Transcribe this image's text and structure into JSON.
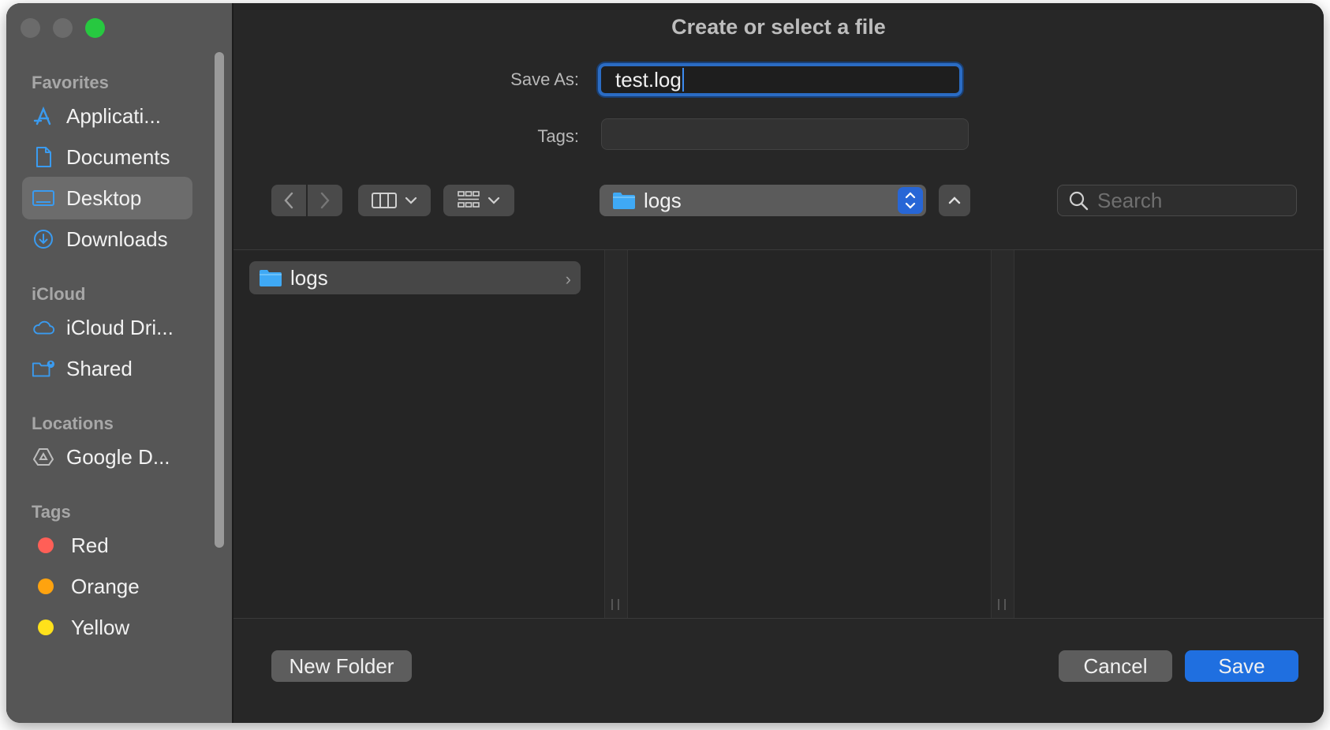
{
  "window": {
    "title": "Create or select a file"
  },
  "sidebar": {
    "favorites_heading": "Favorites",
    "favorites": [
      {
        "label": "Applicati...",
        "icon": "applications-icon",
        "selected": false
      },
      {
        "label": "Documents",
        "icon": "document-icon",
        "selected": false
      },
      {
        "label": "Desktop",
        "icon": "desktop-icon",
        "selected": true
      },
      {
        "label": "Downloads",
        "icon": "downloads-icon",
        "selected": false
      }
    ],
    "icloud_heading": "iCloud",
    "icloud": [
      {
        "label": "iCloud Dri...",
        "icon": "cloud-icon"
      },
      {
        "label": "Shared",
        "icon": "shared-folder-icon"
      }
    ],
    "locations_heading": "Locations",
    "locations": [
      {
        "label": "Google D...",
        "icon": "google-drive-icon"
      }
    ],
    "tags_heading": "Tags",
    "tags": [
      {
        "label": "Red",
        "color": "#ff5f57"
      },
      {
        "label": "Orange",
        "color": "#ffa30f"
      },
      {
        "label": "Yellow",
        "color": "#ffe11b"
      }
    ]
  },
  "form": {
    "save_as_label": "Save As:",
    "save_as_value": "test.log",
    "tags_label": "Tags:",
    "tags_value": ""
  },
  "toolbar": {
    "path_folder": "logs",
    "search_placeholder": "Search"
  },
  "browser": {
    "items": [
      {
        "name": "logs",
        "kind": "folder"
      }
    ]
  },
  "buttons": {
    "new_folder": "New Folder",
    "cancel": "Cancel",
    "save": "Save"
  },
  "colors": {
    "accent": "#1f6fe0",
    "folder": "#3fa9f5",
    "sidebar_icon": "#3a9bf0"
  }
}
